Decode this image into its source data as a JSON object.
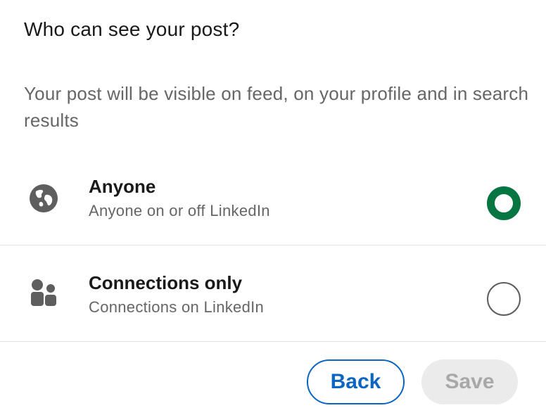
{
  "dialog": {
    "title": "Who can see your post?",
    "description": "Your post will be visible on feed, on your profile and in search results"
  },
  "options": [
    {
      "title": "Anyone",
      "subtitle": "Anyone on or off LinkedIn",
      "icon": "globe-icon",
      "selected": true
    },
    {
      "title": "Connections only",
      "subtitle": "Connections on LinkedIn",
      "icon": "people-icon",
      "selected": false
    }
  ],
  "footer": {
    "back_label": "Back",
    "save_label": "Save"
  },
  "colors": {
    "accent_blue": "#0a66c2",
    "selected_green": "#057642",
    "disabled_bg": "#ebebeb",
    "disabled_text": "#a8a8a8",
    "icon_gray": "#5e5e5e"
  }
}
